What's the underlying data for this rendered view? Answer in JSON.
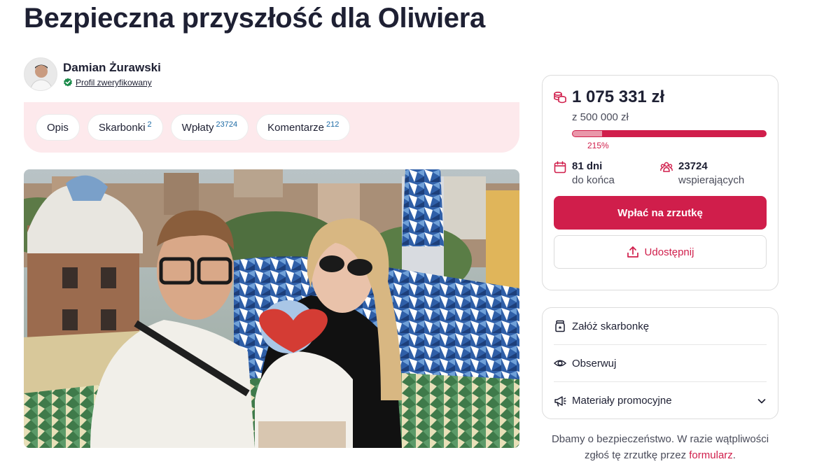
{
  "page": {
    "title": "Bezpieczna przyszłość dla Oliwiera"
  },
  "author": {
    "name": "Damian Żurawski",
    "verified_label": "Profil zweryfikowany"
  },
  "tabs": [
    {
      "label": "Opis",
      "count": ""
    },
    {
      "label": "Skarbonki",
      "count": "2"
    },
    {
      "label": "Wpłaty",
      "count": "23724"
    },
    {
      "label": "Komentarze",
      "count": "212"
    }
  ],
  "funding": {
    "amount": "1 075 331 zł",
    "goal": "z 500 000 zł",
    "progress_percent_label": "215%",
    "progress_fraction": 0.15,
    "days_value": "81 dni",
    "days_label": "do końca",
    "supporters_value": "23724",
    "supporters_label": "wspierających",
    "donate_label": "Wpłać na zrzutkę",
    "share_label": "Udostępnij"
  },
  "menu": {
    "items": [
      {
        "label": "Załóż skarbonkę",
        "icon": "piggy-jar-icon"
      },
      {
        "label": "Obserwuj",
        "icon": "eye-icon"
      },
      {
        "label": "Materiały promocyjne",
        "icon": "megaphone-icon"
      }
    ]
  },
  "safety": {
    "text": "Dbamy o bezpieczeństwo. W razie wątpliwości zgłoś tę zrzutkę przez ",
    "link": "formularz",
    "end": "."
  },
  "colors": {
    "accent": "#d01e4b",
    "tab_bg": "#fde9ec",
    "verified": "#1a8a4a",
    "count_blue": "#1c6aa5"
  }
}
